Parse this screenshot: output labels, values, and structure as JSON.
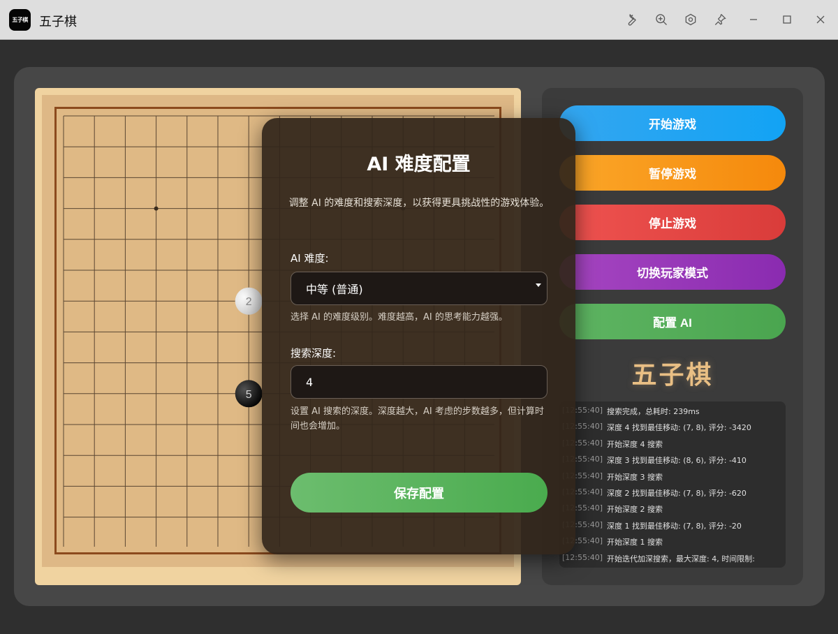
{
  "window": {
    "title": "五子棋",
    "icon_text": "五子棋",
    "toolbar_icons": [
      "wrench-icon",
      "zoom-in-icon",
      "settings-icon",
      "pin-icon"
    ],
    "controls": [
      "minimize-icon",
      "maximize-icon",
      "close-icon"
    ]
  },
  "board": {
    "size": 15,
    "star_points": [
      [
        3,
        3
      ],
      [
        3,
        11
      ]
    ],
    "stones": [
      {
        "row": 6,
        "col": 6,
        "color": "white",
        "label": "2"
      },
      {
        "row": 9,
        "col": 6,
        "color": "black",
        "label": "5"
      }
    ]
  },
  "side": {
    "buttons": {
      "start": "开始游戏",
      "pause": "暂停游戏",
      "stop": "停止游戏",
      "switch_mode": "切换玩家模式",
      "config_ai": "配置 AI"
    },
    "title": "五子棋",
    "log": [
      {
        "time": "[12:55:40]",
        "msg": "搜索完成，总耗时: 239ms"
      },
      {
        "time": "[12:55:40]",
        "msg": "深度 4 找到最佳移动: (7, 8), 评分: -3420"
      },
      {
        "time": "[12:55:40]",
        "msg": "开始深度 4 搜索"
      },
      {
        "time": "[12:55:40]",
        "msg": "深度 3 找到最佳移动: (8, 6), 评分: -410"
      },
      {
        "time": "[12:55:40]",
        "msg": "开始深度 3 搜索"
      },
      {
        "time": "[12:55:40]",
        "msg": "深度 2 找到最佳移动: (7, 8), 评分: -620"
      },
      {
        "time": "[12:55:40]",
        "msg": "开始深度 2 搜索"
      },
      {
        "time": "[12:55:40]",
        "msg": "深度 1 找到最佳移动: (7, 8), 评分: -20"
      },
      {
        "time": "[12:55:40]",
        "msg": "开始深度 1 搜索"
      },
      {
        "time": "[12:55:40]",
        "msg": "开始迭代加深搜索，最大深度: 4, 时间限制:"
      }
    ]
  },
  "modal": {
    "title": "AI 难度配置",
    "description": "调整 AI 的难度和搜索深度，以获得更具挑战性的游戏体验。",
    "difficulty": {
      "label": "AI 难度:",
      "value": "中等 (普通)",
      "help": "选择 AI 的难度级别。难度越高，AI 的思考能力越强。"
    },
    "depth": {
      "label": "搜索深度:",
      "value": "4",
      "help": "设置 AI 搜索的深度。深度越大，AI 考虑的步数越多，但计算时间也会增加。"
    },
    "save_label": "保存配置"
  },
  "colors": {
    "board": "#dfb985",
    "frame": "#8b4a1d",
    "accent_start": "#12a3f4",
    "accent_pause": "#f5890c",
    "accent_stop": "#d93c3a",
    "accent_switch": "#8a2bb0",
    "accent_config": "#4aa54f"
  }
}
